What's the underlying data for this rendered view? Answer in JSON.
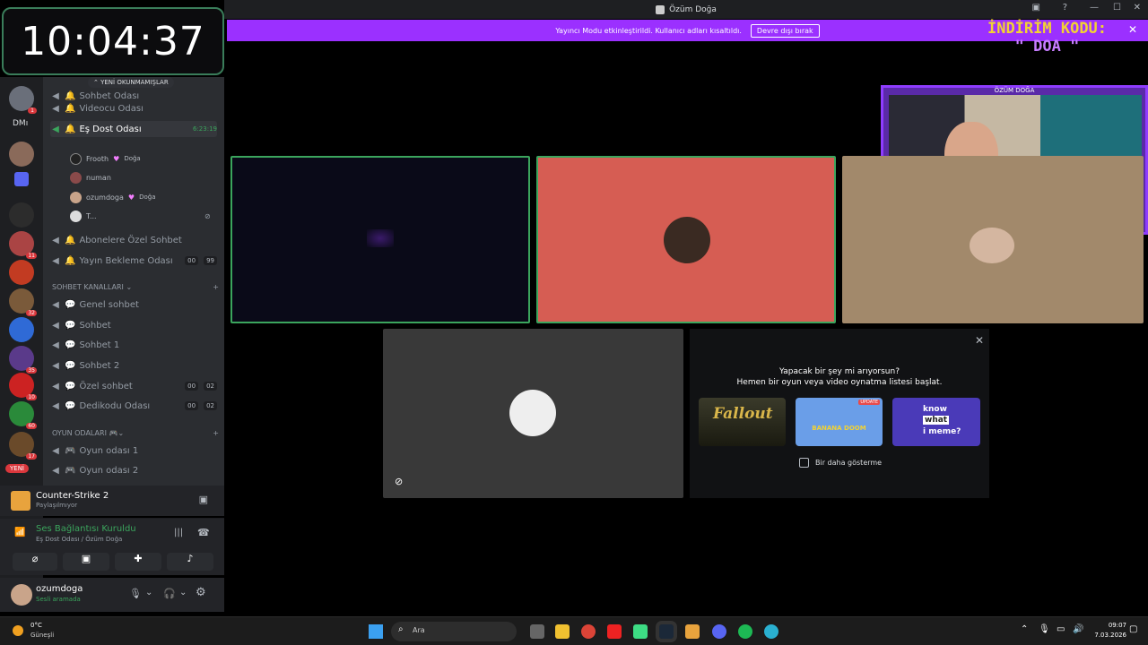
{
  "window": {
    "title": "Özüm Doğa"
  },
  "banner": {
    "text": "Yayıncı Modu etkinleştirildi. Kullanıcı adları kısaltıldı.",
    "button": "Devre dışı bırak"
  },
  "clock": {
    "time": "10:04:37"
  },
  "overlay": {
    "promo_line1": "İNDİRİM KODU:",
    "promo_line2": "\" DOA \"",
    "cam_label": "ÖZÜM DOĞA"
  },
  "rail": {
    "dm_label": "DMı",
    "new_label": "YENİ",
    "badges": [
      "1",
      "11",
      "32",
      "35",
      "10",
      "60",
      "17"
    ]
  },
  "channels": {
    "unread_pill": "YENİ OKUNMAMIŞLAR",
    "top": [
      {
        "name": "Sohbet Odası",
        "icon": "bell"
      },
      {
        "name": "Videocu Odası",
        "icon": "bell"
      },
      {
        "name": "Eş Dost Odası",
        "icon": "bell",
        "time": "6:23:19"
      }
    ],
    "members": [
      {
        "name": "Frooth",
        "tag": "Doğa"
      },
      {
        "name": "numan",
        "tag": ""
      },
      {
        "name": "ozumdoga",
        "tag": "Doğa"
      },
      {
        "name": "T...",
        "tag": ""
      }
    ],
    "mid": [
      {
        "name": "Abonelere Özel Sohbet"
      },
      {
        "name": "Yayın Bekleme Odası",
        "c1": "00",
        "c2": "99"
      }
    ],
    "cat1": "SOHBET KANALLARI",
    "chat": [
      {
        "name": "Genel sohbet"
      },
      {
        "name": "Sohbet"
      },
      {
        "name": "Sohbet 1"
      },
      {
        "name": "Sohbet 2"
      },
      {
        "name": "Özel sohbet",
        "c1": "00",
        "c2": "02"
      },
      {
        "name": "Dedikodu Odası",
        "c1": "00",
        "c2": "02"
      }
    ],
    "cat2": "OYUN ODALARI",
    "games": [
      {
        "name": "Oyun odası 1"
      },
      {
        "name": "Oyun odası 2"
      }
    ]
  },
  "activity": {
    "game": "Counter-Strike 2",
    "status": "Paylaşılmıyor"
  },
  "voice": {
    "status": "Ses Bağlantısı Kuruldu",
    "channel": "Eş Dost Odası / Özüm Doğa"
  },
  "userpanel": {
    "name": "ozumdoga",
    "status": "Sesli aramada"
  },
  "activity_popup": {
    "line1": "Yapacak bir şey mi arıyorsun?",
    "line2": "Hemen bir oyun veya video oynatma listesi başlat.",
    "checkbox": "Bir daha gösterme",
    "card1": "Fallout",
    "card2": "BANANA DOOM",
    "card2_badge": "UPDATE",
    "card3_line1": "know",
    "card3_line2": "what",
    "card3_line3": "i meme?"
  },
  "taskbar": {
    "weather_temp": "0°C",
    "weather_text": "Güneşli",
    "search": "Ara",
    "time": "09:07",
    "date": "7.03.2026"
  },
  "colors": {
    "accent": "#9b30ff",
    "speaking": "#3ba55d",
    "tile_red": "#d65d53",
    "tile_tan": "#a2896b"
  }
}
